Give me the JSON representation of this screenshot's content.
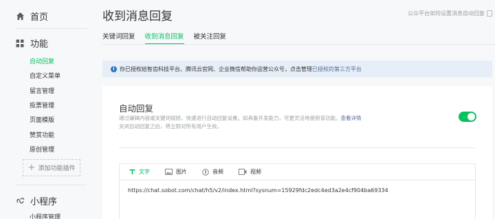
{
  "sidebar": {
    "home_label": "首页",
    "features_label": "功能",
    "items": [
      {
        "label": "自动回复",
        "active": true
      },
      {
        "label": "自定义菜单",
        "active": false
      },
      {
        "label": "留言管理",
        "active": false
      },
      {
        "label": "投票管理",
        "active": false
      },
      {
        "label": "页面模版",
        "active": false
      },
      {
        "label": "赞赏功能",
        "active": false
      },
      {
        "label": "原创管理",
        "active": false
      }
    ],
    "add_plugin_label": "添加功能插件",
    "miniprogram_label": "小程序",
    "miniprogram_items": [
      {
        "label": "小程序管理"
      }
    ]
  },
  "header": {
    "title": "收到消息回复",
    "help_text": "公众平台如何设置消息自动回复"
  },
  "tabs": [
    {
      "label": "关键词回复",
      "active": false
    },
    {
      "label": "收到消息回复",
      "active": true
    },
    {
      "label": "被关注回复",
      "active": false
    }
  ],
  "notice": {
    "text": "你已授权给智齿科技平台、腾讯云官网、企业微信帮助你运营公众号，点击管理",
    "link": "已授权的第三方平台"
  },
  "card": {
    "title": "自动回复",
    "desc_line1": "通过编辑内容或关键词规则，快速进行自动回复设置。如具备开发能力，可更灵活地使用该功能。",
    "desc_link": "查看详情",
    "desc_line2": "关闭自动回复之后，将立即对所有用户生效。",
    "toggle_on": true
  },
  "editor": {
    "tools": [
      {
        "label": "文字",
        "icon": "text-icon",
        "active": true
      },
      {
        "label": "图片",
        "icon": "image-icon",
        "active": false
      },
      {
        "label": "音频",
        "icon": "audio-icon",
        "active": false
      },
      {
        "label": "视频",
        "icon": "video-icon",
        "active": false
      }
    ],
    "content": "https://chat.sobot.com/chat/h5/v2/index.html?sysnum=15929fdc2edc4ed3a2e4cf904ba69334"
  },
  "colors": {
    "accent": "#07c160",
    "link": "#576b95",
    "notice_bg": "#e6eef8"
  }
}
